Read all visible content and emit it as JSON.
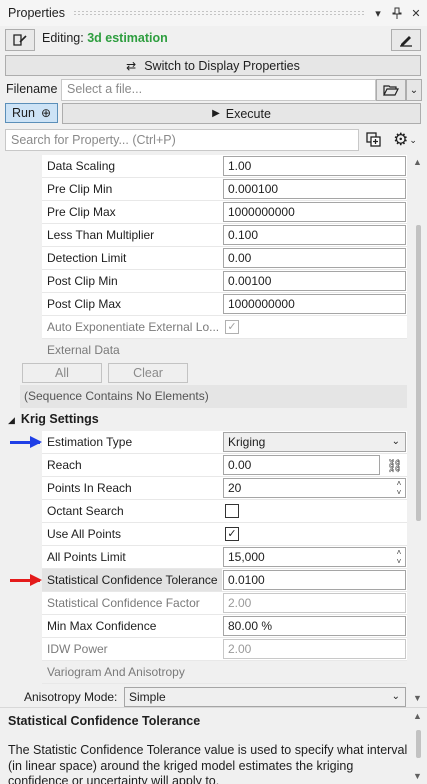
{
  "panel": {
    "title": "Properties",
    "pin_icon": "pin-icon",
    "close_icon": "close-icon"
  },
  "editing": {
    "prefix": "Editing:",
    "document": "3d estimation"
  },
  "switch_button": "Switch to Display Properties",
  "filename": {
    "label": "Filename",
    "placeholder": "Select a file..."
  },
  "run_button": "Run",
  "execute_button": "Execute",
  "search": {
    "placeholder": "Search for Property... (Ctrl+P)"
  },
  "rows_top": [
    {
      "name": "Data Scaling",
      "value": "1.00"
    },
    {
      "name": "Pre Clip Min",
      "value": "0.000100"
    },
    {
      "name": "Pre Clip Max",
      "value": "1000000000"
    },
    {
      "name": "Less Than Multiplier",
      "value": "0.100"
    },
    {
      "name": "Detection Limit",
      "value": "0.00"
    },
    {
      "name": "Post Clip Min",
      "value": "0.00100"
    },
    {
      "name": "Post Clip Max",
      "value": "1000000000"
    },
    {
      "name": "Auto Exponentiate External Lo...",
      "checked": true,
      "disabled": true
    },
    {
      "name": "External Data"
    }
  ],
  "external_buttons": {
    "all": "All",
    "clear": "Clear"
  },
  "sequence_note": "(Sequence Contains No Elements)",
  "category": "Krig Settings",
  "krig_rows": [
    {
      "name": "Estimation Type",
      "value": "Kriging",
      "type": "combo"
    },
    {
      "name": "Reach",
      "value": "0.00",
      "type": "link"
    },
    {
      "name": "Points In Reach",
      "value": "20",
      "type": "spin"
    },
    {
      "name": "Octant Search",
      "type": "check",
      "checked": false
    },
    {
      "name": "Use All Points",
      "type": "check",
      "checked": true
    },
    {
      "name": "All Points Limit",
      "value": "15,000",
      "type": "spin"
    },
    {
      "name": "Statistical Confidence Tolerance",
      "value": "0.0100",
      "type": "text",
      "selected": true
    },
    {
      "name": "Statistical Confidence Factor",
      "value": "2.00",
      "type": "disabled"
    },
    {
      "name": "Min Max Confidence",
      "value": "80.00 %",
      "type": "text"
    },
    {
      "name": "IDW Power",
      "value": "2.00",
      "type": "disabled"
    },
    {
      "name": "Variogram And Anisotropy",
      "type": "header"
    }
  ],
  "anisotropy": {
    "label": "Anisotropy Mode:",
    "value": "Simple"
  },
  "description": {
    "title": "Statistical Confidence Tolerance",
    "line1": "The Statistic Confidence Tolerance value is used to specify what interval",
    "line2": "(in linear space) around the kriged model estimates the kriging",
    "line3": "confidence or uncertainty will apply to."
  },
  "annotation_colors": {
    "blue_arrow": "#1f3fe6",
    "red_arrow": "#e41b1b"
  }
}
